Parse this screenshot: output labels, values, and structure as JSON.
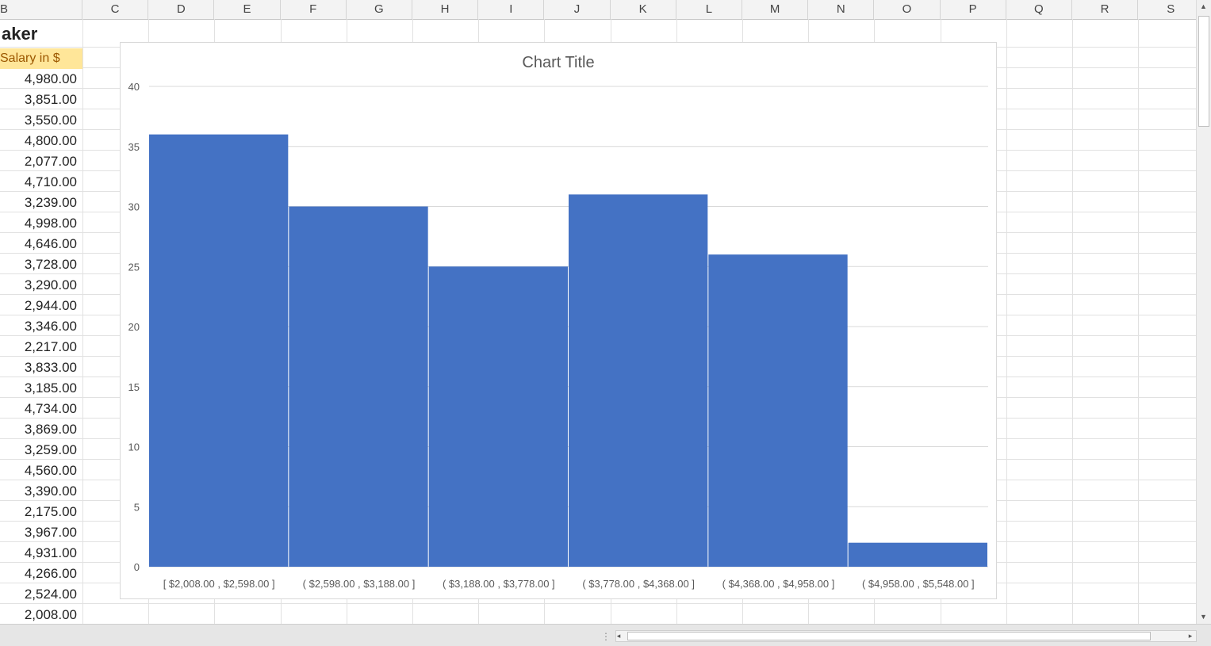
{
  "columns": [
    "B",
    "C",
    "D",
    "E",
    "F",
    "G",
    "H",
    "I",
    "J",
    "K",
    "L",
    "M",
    "N",
    "O",
    "P",
    "Q",
    "R",
    "S"
  ],
  "sheet": {
    "title_fragment": "aker",
    "column_header": "Salary in $",
    "salaries": [
      "4,980.00",
      "3,851.00",
      "3,550.00",
      "4,800.00",
      "2,077.00",
      "4,710.00",
      "3,239.00",
      "4,998.00",
      "4,646.00",
      "3,728.00",
      "3,290.00",
      "2,944.00",
      "3,346.00",
      "2,217.00",
      "3,833.00",
      "3,185.00",
      "4,734.00",
      "3,869.00",
      "3,259.00",
      "4,560.00",
      "3,390.00",
      "2,175.00",
      "3,967.00",
      "4,931.00",
      "4,266.00",
      "2,524.00",
      "2,008.00"
    ]
  },
  "chart_data": {
    "type": "bar",
    "title": "Chart Title",
    "categories": [
      "[ $2,008.00 ,  $2,598.00 ]",
      "( $2,598.00 ,  $3,188.00 ]",
      "( $3,188.00 ,  $3,778.00 ]",
      "( $3,778.00 ,  $4,368.00 ]",
      "( $4,368.00 ,  $4,958.00 ]",
      "( $4,958.00 ,  $5,548.00 ]"
    ],
    "values": [
      36,
      30,
      25,
      31,
      26,
      2
    ],
    "ylim": [
      0,
      40
    ],
    "yticks": [
      0,
      5,
      10,
      15,
      20,
      25,
      30,
      35,
      40
    ],
    "grid": true,
    "bar_color": "#4472c4"
  },
  "colors": {
    "accent": "#4472c4",
    "header_fill": "#ffe699"
  }
}
